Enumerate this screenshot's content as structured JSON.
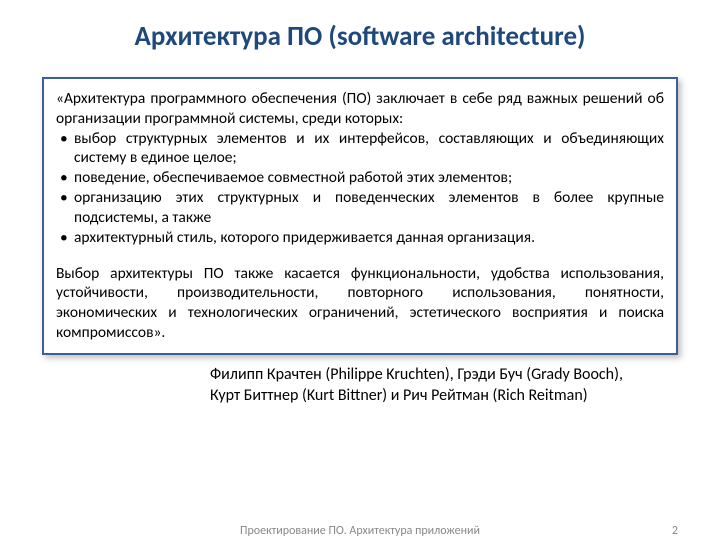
{
  "title": "Архитектура ПО (software architecture)",
  "quote": {
    "intro": "«Архитектура программного обеспечения (ПО) заключает в себе ряд важных решений об организации программной системы, среди которых:",
    "bullets": [
      "выбор структурных элементов и их интерфейсов, составляющих и объединяющих систему в единое целое;",
      "поведение, обеспечиваемое совместной работой этих элементов;",
      "организацию этих структурных и поведенческих элементов в более крупные подсистемы, а также",
      "архитектурный стиль, которого придерживается данная организация."
    ],
    "closing": "Выбор архитектуры ПО также касается функциональности, удобства использования, устойчивости, производительности, повторного использования, понятности, экономических и технологических ограничений, эстетического восприятия и поиска компромиссов»."
  },
  "attribution": {
    "line1": "Филипп Крачтен (Philippe Kruchten), Грэди Буч (Grady Booch),",
    "line2": "Курт Биттнер (Kurt Bittner) и Рич Рейтман (Rich Reitman)"
  },
  "footer": {
    "text": "Проектирование ПО. Архитектура приложений",
    "page": "2"
  }
}
